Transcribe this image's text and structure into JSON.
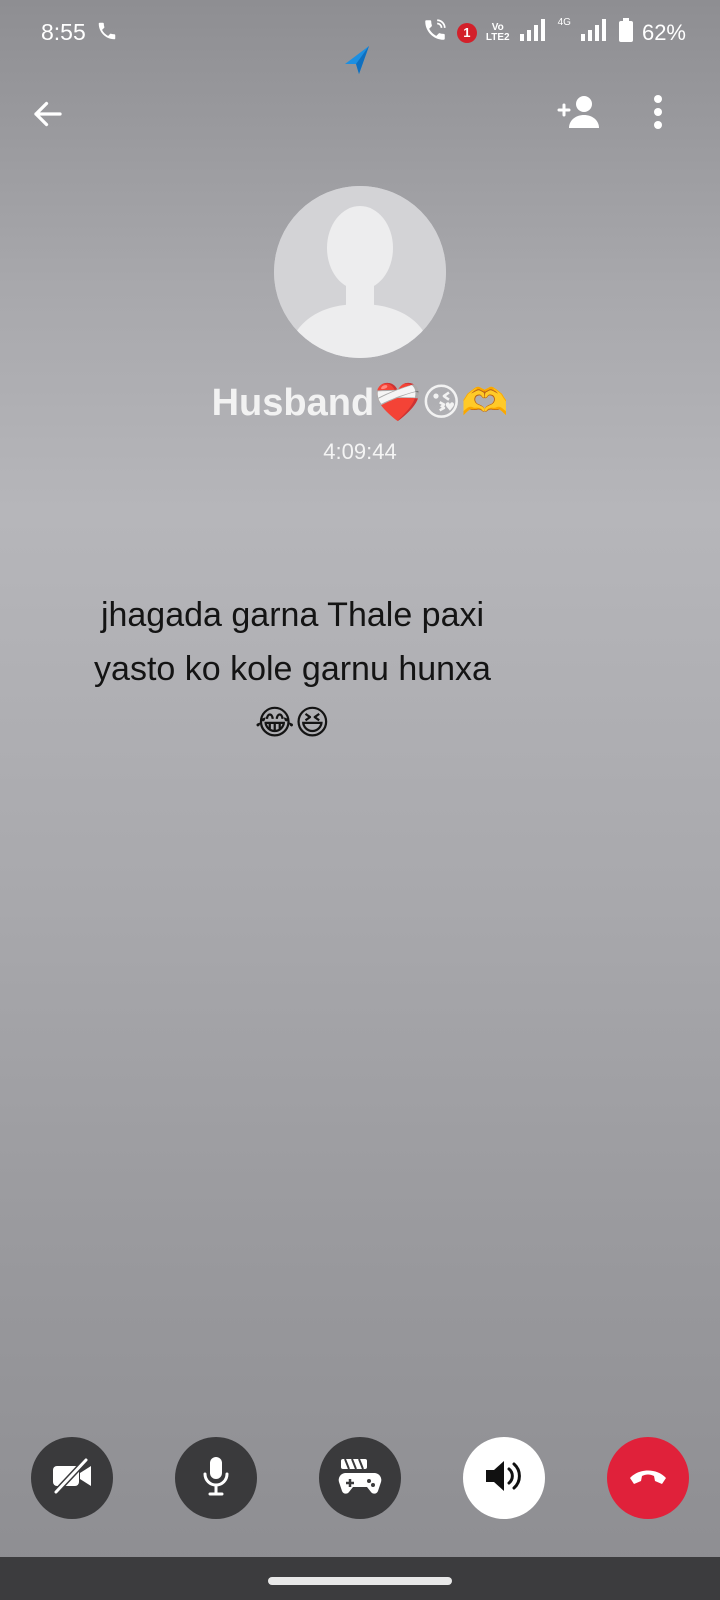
{
  "status_bar": {
    "time": "8:55",
    "notification_count": "1",
    "volte_label": "Vo\nLTE2",
    "network_label": "4G",
    "battery": "62%"
  },
  "call": {
    "caller_name": "Husband❤️‍🩹😘🫶",
    "duration": "4:09:44"
  },
  "caption": {
    "line1": "jhagada garna Thale paxi",
    "line2": "yasto ko kole garnu hunxa",
    "line3": "😂😆"
  },
  "controls": [
    "camera-off",
    "microphone",
    "games",
    "speaker",
    "end-call"
  ],
  "colors": {
    "end_call": "#e0213a",
    "button_dark": "#3a3a3c",
    "speaker_active": "#ffffff"
  }
}
